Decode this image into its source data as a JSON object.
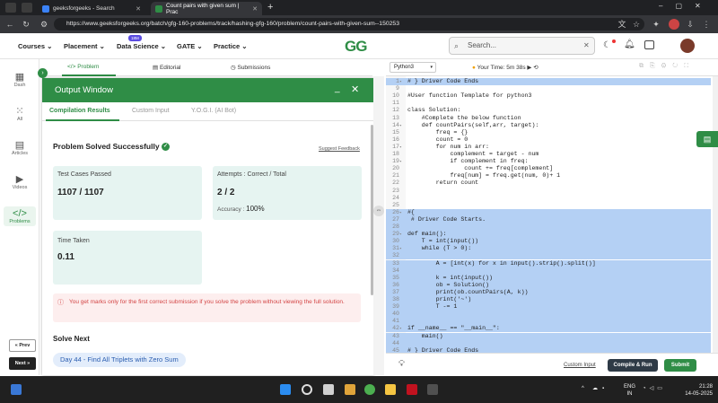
{
  "browser": {
    "tabs": [
      {
        "title": "geeksforgeeks - Search",
        "active": false
      },
      {
        "title": "Count pairs with given sum | Prac",
        "active": true
      }
    ],
    "new_tab": "+",
    "url": "https://www.geeksforgeeks.org/batch/gfg-160-problems/track/hashing-gfg-160/problem/count-pairs-with-given-sum--150253"
  },
  "site_header": {
    "menus": [
      "Courses",
      "Placement",
      "Data Science",
      "GATE",
      "Practice"
    ],
    "data_science_badge": "18M",
    "logo": "GG",
    "search_placeholder": "Search..."
  },
  "left_tabs": [
    "Problem",
    "Editorial",
    "Submissions"
  ],
  "sidebar": {
    "items": [
      {
        "label": "Dash",
        "icon": "dashboard-icon"
      },
      {
        "label": "All",
        "icon": "grid-icon"
      },
      {
        "label": "Articles",
        "icon": "article-icon"
      },
      {
        "label": "Videos",
        "icon": "video-icon"
      },
      {
        "label": "Problems",
        "icon": "code-icon",
        "active": true
      }
    ],
    "prev": "« Prev",
    "next": "Next »"
  },
  "output_window": {
    "title": "Output Window",
    "tabs": [
      "Compilation Results",
      "Custom Input",
      "Y.O.G.I. (AI Bot)"
    ],
    "status": "Problem Solved Successfully",
    "suggest_feedback": "Suggest Feedback",
    "test_cases_label": "Test Cases Passed",
    "test_cases_value": "1107 / 1107",
    "attempts_label": "Attempts : Correct / Total",
    "attempts_value": "2 / 2",
    "accuracy_label": "Accuracy :",
    "accuracy_value": "100%",
    "time_label": "Time Taken",
    "time_value": "0.11",
    "warning": "You get marks only for the first correct submission if you solve the problem without viewing the full solution.",
    "solve_next_heading": "Solve Next",
    "solve_next_item": "Day 44 - Find All Triplets with Zero Sum"
  },
  "editor": {
    "language": "Python3",
    "timer_label": "Your Time: 5m 38s",
    "lines": [
      {
        "n": "1",
        "text": "# } Driver Code Ends",
        "sel": true
      },
      {
        "n": "9",
        "text": ""
      },
      {
        "n": "10",
        "text": "#User function Template for python3"
      },
      {
        "n": "11",
        "text": ""
      },
      {
        "n": "12",
        "text": "class Solution:"
      },
      {
        "n": "13",
        "text": "    #Complete the below function"
      },
      {
        "n": "14",
        "text": "    def countPairs(self,arr, target):"
      },
      {
        "n": "15",
        "text": "        freq = {}"
      },
      {
        "n": "16",
        "text": "        count = 0"
      },
      {
        "n": "17",
        "text": "        for num in arr:"
      },
      {
        "n": "18",
        "text": "            complement = target - num"
      },
      {
        "n": "19",
        "text": "            if complement in freq:"
      },
      {
        "n": "20",
        "text": "                count += freq[complement]"
      },
      {
        "n": "21",
        "text": "            freq[num] = freq.get(num, 0)+ 1"
      },
      {
        "n": "22",
        "text": "        return count"
      },
      {
        "n": "23",
        "text": ""
      },
      {
        "n": "24",
        "text": ""
      },
      {
        "n": "25",
        "text": ""
      },
      {
        "n": "26",
        "text": "#{",
        "sel": true
      },
      {
        "n": "27",
        "text": " # Driver Code Starts.",
        "sel": true
      },
      {
        "n": "28",
        "text": "",
        "sel": true
      },
      {
        "n": "29",
        "text": "def main():",
        "sel": true
      },
      {
        "n": "30",
        "text": "    T = int(input())",
        "sel": true
      },
      {
        "n": "31",
        "text": "    while (T > 0):",
        "sel": true
      },
      {
        "n": "32",
        "text": "",
        "sel": true
      },
      {
        "n": "33",
        "text": "        A = [int(x) for x in input().strip().split()]",
        "sel": true
      },
      {
        "n": "34",
        "text": "",
        "sel": true
      },
      {
        "n": "35",
        "text": "        k = int(input())",
        "sel": true
      },
      {
        "n": "36",
        "text": "        ob = Solution()",
        "sel": true
      },
      {
        "n": "37",
        "text": "        print(ob.countPairs(A, k))",
        "sel": true
      },
      {
        "n": "38",
        "text": "        print('~')",
        "sel": true
      },
      {
        "n": "39",
        "text": "        T -= 1",
        "sel": true
      },
      {
        "n": "40",
        "text": "",
        "sel": true
      },
      {
        "n": "41",
        "text": "",
        "sel": true
      },
      {
        "n": "42",
        "text": "if __name__ == \"__main__\":",
        "sel": true
      },
      {
        "n": "43",
        "text": "    main()",
        "sel": true
      },
      {
        "n": "44",
        "text": "",
        "sel": true
      },
      {
        "n": "45",
        "text": "# } Driver Code Ends",
        "sel": true
      }
    ],
    "custom_input": "Custom Input",
    "compile_run": "Compile & Run",
    "submit": "Submit"
  },
  "taskbar": {
    "lang_top": "ENG",
    "lang_bottom": "IN",
    "time": "21:28",
    "date": "14-05-2025"
  },
  "colors": {
    "accent": "#2f8d46",
    "selection": "#b4d0f4",
    "warning": "#d34545"
  }
}
